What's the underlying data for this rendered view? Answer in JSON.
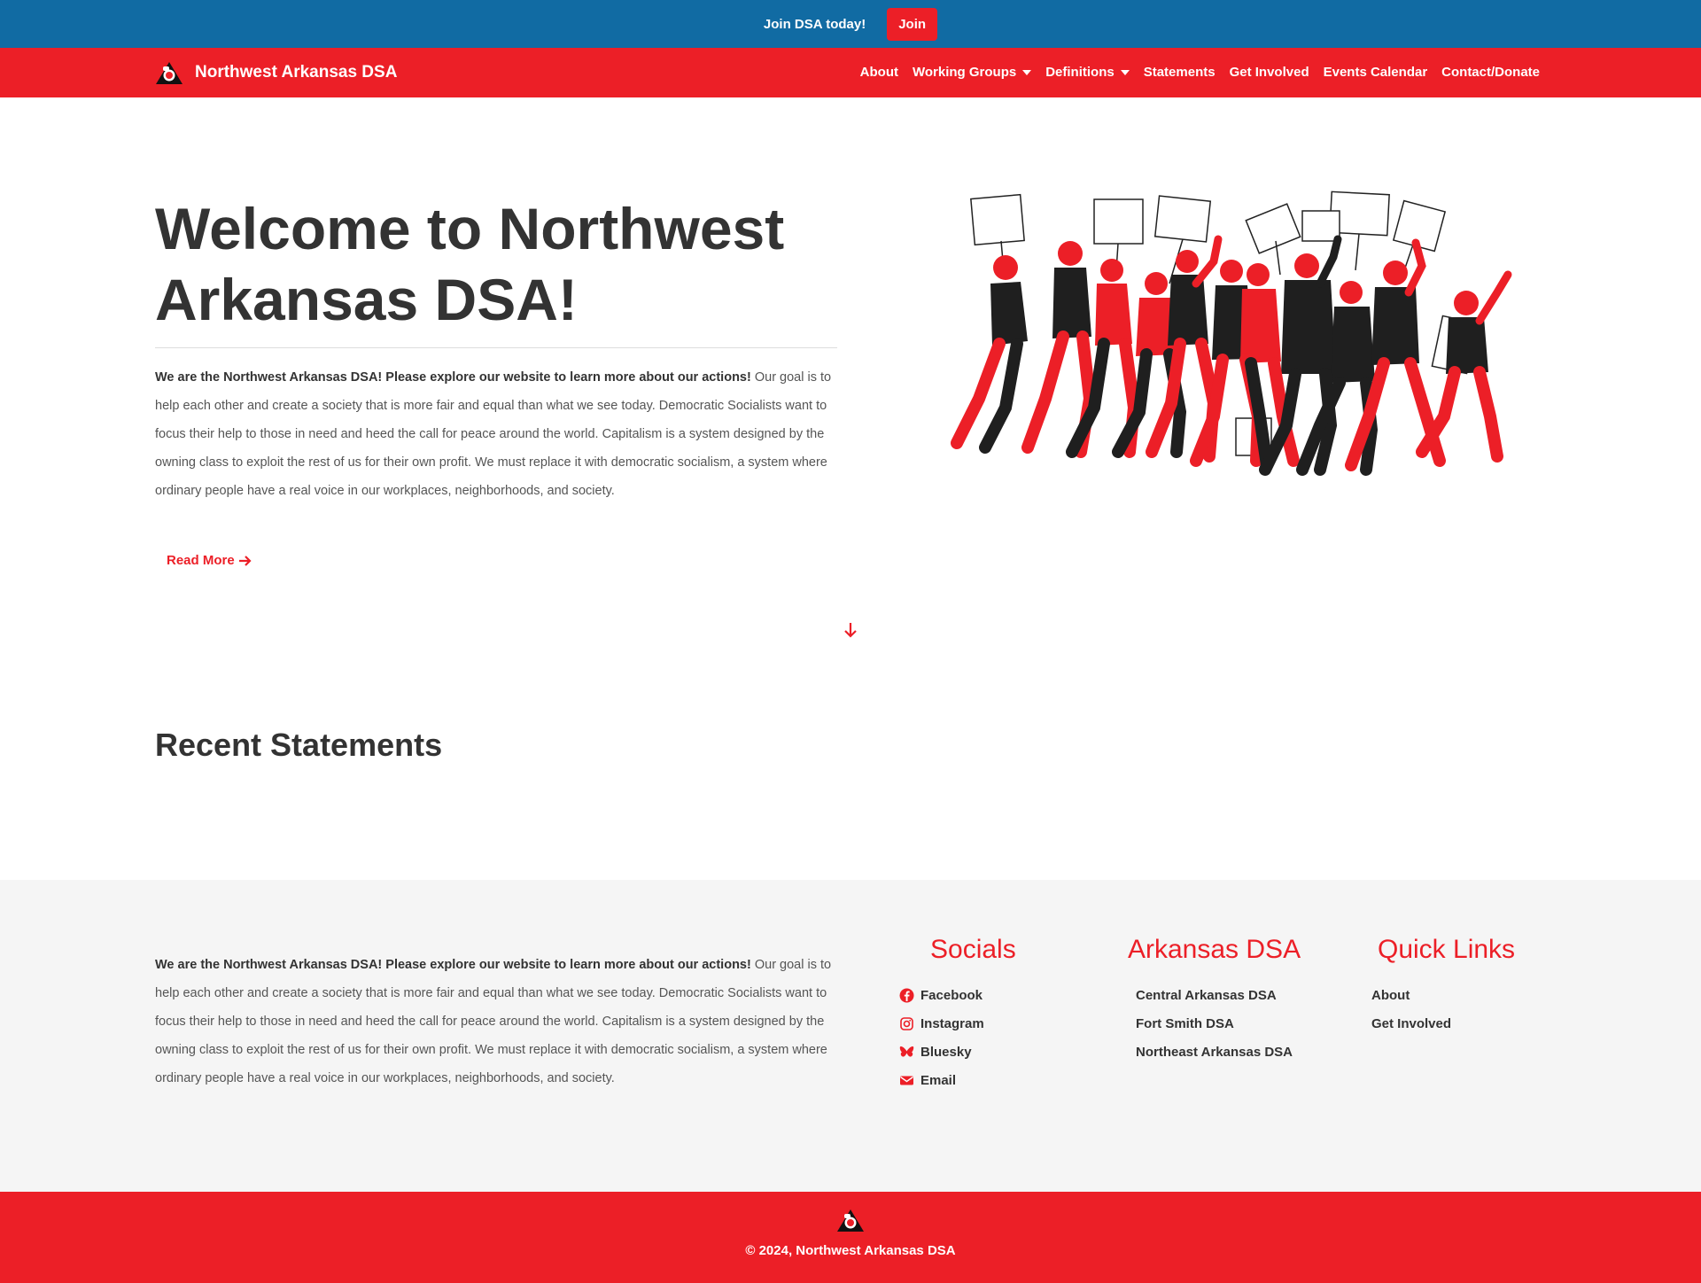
{
  "announcement": {
    "text": "Join DSA today!",
    "button": "Join"
  },
  "brand": {
    "name": "Northwest Arkansas DSA",
    "logo_icon": "rose-fist-logo"
  },
  "nav": {
    "items": [
      {
        "label": "About"
      },
      {
        "label": "Working Groups",
        "dropdown": true
      },
      {
        "label": "Definitions",
        "dropdown": true
      },
      {
        "label": "Statements"
      },
      {
        "label": "Get Involved"
      },
      {
        "label": "Events Calendar"
      },
      {
        "label": "Contact/Donate"
      }
    ]
  },
  "hero": {
    "title": "Welcome to Northwest Arkansas DSA!",
    "intro_bold": "We are the Northwest Arkansas DSA! Please explore our website to learn more about our actions!",
    "intro_rest": " Our goal is to help each other and create a society that is more fair and equal than what we see today. Democratic Socialists want to focus their help to those in need and heed the call for peace around the world. Capitalism is a system designed by the owning class to exploit the rest of us for their own profit. We must replace it with democratic socialism, a system where ordinary people have a real voice in our workplaces, neighborhoods, and society.",
    "read_more": "Read More",
    "image_icon": "marching-protesters-illustration"
  },
  "statements": {
    "title": "Recent Statements"
  },
  "footer": {
    "intro_bold": "We are the Northwest Arkansas DSA! Please explore our website to learn more about our actions!",
    "intro_rest": " Our goal is to help each other and create a society that is more fair and equal than what we see today. Democratic Socialists want to focus their help to those in need and heed the call for peace around the world. Capitalism is a system designed by the owning class to exploit the rest of us for their own profit. We must replace it with democratic socialism, a system where ordinary people have a real voice in our workplaces, neighborhoods, and society.",
    "socials": {
      "title": "Socials",
      "links": [
        {
          "label": "Facebook",
          "icon": "facebook-icon"
        },
        {
          "label": "Instagram",
          "icon": "instagram-icon"
        },
        {
          "label": "Bluesky",
          "icon": "bluesky-icon"
        },
        {
          "label": "Email",
          "icon": "email-icon"
        }
      ]
    },
    "arkansas": {
      "title": "Arkansas DSA",
      "links": [
        "Central Arkansas DSA",
        "Fort Smith DSA",
        "Northeast Arkansas DSA"
      ]
    },
    "quick": {
      "title": "Quick Links",
      "links": [
        "About",
        "Get Involved"
      ]
    },
    "copyright": "© 2024, Northwest Arkansas DSA"
  },
  "colors": {
    "top_bar": "#116ba3",
    "brand_red": "#ec1f27",
    "text": "#333333",
    "footer_bg": "#f5f5f5"
  }
}
